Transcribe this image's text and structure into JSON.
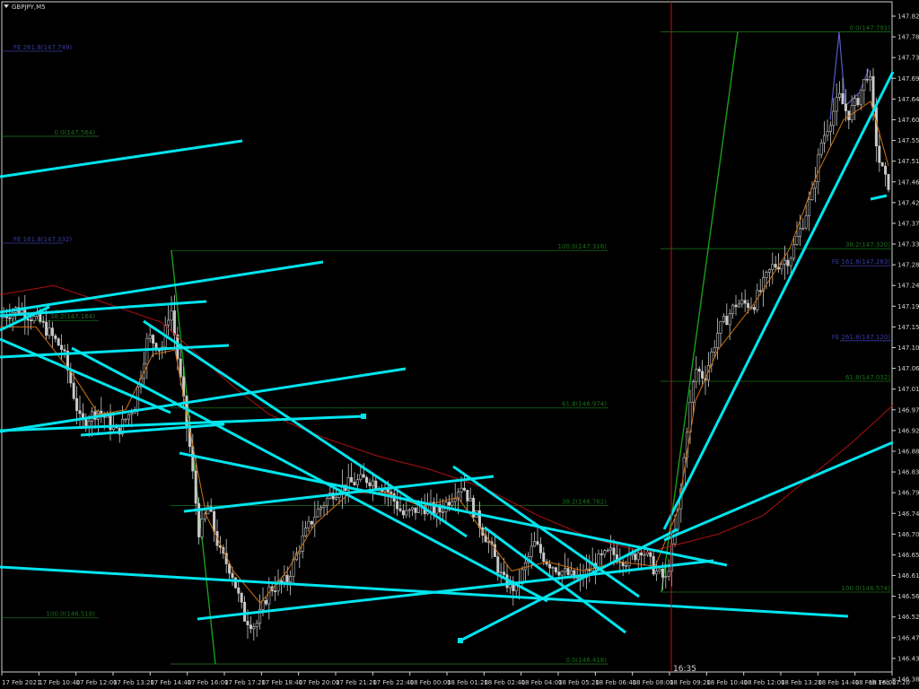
{
  "symbol_title": "GBPJPY,M5",
  "cursor_time": "16:35",
  "colors": {
    "background": "#000000",
    "grid_border": "#d0d0d0",
    "trendline": "#00e5ee",
    "fib_retracement": "#1a6e1a",
    "fib_expansion": "#3a3aa0",
    "ma_fast": "#d07010",
    "ma_slow": "#b01010",
    "candle": "#c8c8c8",
    "cursor_line": "#c01010"
  },
  "chart_data": {
    "type": "candlestick",
    "ylim": [
      146.385,
      147.82
    ],
    "y_ticks": [
      "147.825",
      "147.780",
      "147.735",
      "147.690",
      "147.645",
      "147.600",
      "147.555",
      "147.510",
      "147.465",
      "147.420",
      "147.375",
      "147.330",
      "147.285",
      "147.240",
      "147.195",
      "147.150",
      "147.105",
      "147.060",
      "147.015",
      "146.970",
      "146.925",
      "146.880",
      "146.835",
      "146.790",
      "146.745",
      "146.700",
      "146.655",
      "146.610",
      "146.565",
      "146.520",
      "146.475",
      "146.430",
      "146.385"
    ],
    "x_ticks": [
      "17 Feb 2021",
      "17 Feb 10:40",
      "17 Feb 12:00",
      "17 Feb 13:20",
      "17 Feb 14:40",
      "17 Feb 16:00",
      "17 Feb 17:20",
      "17 Feb 18:40",
      "17 Feb 20:00",
      "17 Feb 21:20",
      "17 Feb 22:40",
      "18 Feb 00:00",
      "18 Feb 01:20",
      "18 Feb 02:40",
      "18 Feb 04:00",
      "18 Feb 05:20",
      "18 Feb 06:40",
      "18 Feb 08:00",
      "18 Feb 09:20",
      "18 Feb 10:40",
      "18 Feb 12:00",
      "18 Feb 13:20",
      "18 Feb 14:40",
      "18 Feb 16:00",
      "18 Feb 17:20"
    ],
    "price_path": [
      [
        0,
        147.17
      ],
      [
        20,
        147.19
      ],
      [
        45,
        147.16
      ],
      [
        70,
        147.1
      ],
      [
        90,
        146.94
      ],
      [
        110,
        146.97
      ],
      [
        130,
        146.92
      ],
      [
        150,
        146.98
      ],
      [
        165,
        147.13
      ],
      [
        180,
        147.1
      ],
      [
        190,
        147.2
      ],
      [
        200,
        147.05
      ],
      [
        212,
        146.88
      ],
      [
        222,
        146.7
      ],
      [
        232,
        146.76
      ],
      [
        245,
        146.66
      ],
      [
        258,
        146.62
      ],
      [
        272,
        146.52
      ],
      [
        285,
        146.5
      ],
      [
        300,
        146.58
      ],
      [
        320,
        146.6
      ],
      [
        335,
        146.68
      ],
      [
        350,
        146.74
      ],
      [
        370,
        146.79
      ],
      [
        390,
        146.81
      ],
      [
        410,
        146.82
      ],
      [
        430,
        146.8
      ],
      [
        450,
        146.74
      ],
      [
        470,
        146.76
      ],
      [
        490,
        146.75
      ],
      [
        515,
        146.81
      ],
      [
        530,
        146.74
      ],
      [
        545,
        146.68
      ],
      [
        560,
        146.6
      ],
      [
        575,
        146.58
      ],
      [
        595,
        146.68
      ],
      [
        610,
        146.64
      ],
      [
        625,
        146.62
      ],
      [
        645,
        146.6
      ],
      [
        665,
        146.64
      ],
      [
        680,
        146.66
      ],
      [
        700,
        146.64
      ],
      [
        715,
        146.67
      ],
      [
        730,
        146.62
      ],
      [
        742,
        146.6
      ],
      [
        750,
        146.68
      ],
      [
        758,
        146.78
      ],
      [
        766,
        146.94
      ],
      [
        775,
        147.06
      ],
      [
        785,
        147.04
      ],
      [
        800,
        147.14
      ],
      [
        820,
        147.2
      ],
      [
        840,
        147.2
      ],
      [
        860,
        147.28
      ],
      [
        880,
        147.3
      ],
      [
        895,
        147.38
      ],
      [
        905,
        147.44
      ],
      [
        915,
        147.55
      ],
      [
        925,
        147.6
      ],
      [
        935,
        147.65
      ],
      [
        945,
        147.61
      ],
      [
        955,
        147.64
      ],
      [
        968,
        147.71
      ],
      [
        978,
        147.52
      ],
      [
        988,
        147.46
      ]
    ],
    "ma_fast_path": [
      [
        0,
        147.15
      ],
      [
        40,
        147.15
      ],
      [
        80,
        147.05
      ],
      [
        110,
        146.96
      ],
      [
        140,
        146.97
      ],
      [
        170,
        147.09
      ],
      [
        195,
        147.1
      ],
      [
        210,
        146.94
      ],
      [
        230,
        146.74
      ],
      [
        260,
        146.62
      ],
      [
        290,
        146.55
      ],
      [
        320,
        146.62
      ],
      [
        350,
        146.72
      ],
      [
        390,
        146.79
      ],
      [
        430,
        146.79
      ],
      [
        470,
        146.76
      ],
      [
        510,
        146.78
      ],
      [
        540,
        146.7
      ],
      [
        570,
        146.62
      ],
      [
        610,
        146.64
      ],
      [
        650,
        146.62
      ],
      [
        690,
        146.64
      ],
      [
        730,
        146.63
      ],
      [
        755,
        146.75
      ],
      [
        775,
        146.99
      ],
      [
        800,
        147.1
      ],
      [
        840,
        147.2
      ],
      [
        880,
        147.32
      ],
      [
        910,
        147.48
      ],
      [
        940,
        147.6
      ],
      [
        970,
        147.64
      ],
      [
        990,
        147.5
      ]
    ],
    "ma_slow_path": [
      [
        0,
        147.22
      ],
      [
        60,
        147.24
      ],
      [
        120,
        147.2
      ],
      [
        180,
        147.16
      ],
      [
        220,
        147.09
      ],
      [
        260,
        147.02
      ],
      [
        300,
        146.96
      ],
      [
        360,
        146.91
      ],
      [
        420,
        146.87
      ],
      [
        480,
        146.84
      ],
      [
        540,
        146.8
      ],
      [
        600,
        146.74
      ],
      [
        660,
        146.69
      ],
      [
        720,
        146.66
      ],
      [
        760,
        146.68
      ],
      [
        800,
        146.7
      ],
      [
        850,
        146.74
      ],
      [
        900,
        146.82
      ],
      [
        950,
        146.9
      ],
      [
        995,
        146.98
      ]
    ]
  },
  "fib_retracement_1": {
    "levels": [
      {
        "text": "100.0(147.316)",
        "price": 147.316
      },
      {
        "text": "61.8(146.974)",
        "price": 146.974
      },
      {
        "text": "38.2(146.762)",
        "price": 146.762
      },
      {
        "text": "0.0(146.418)",
        "price": 146.418
      }
    ]
  },
  "fib_retracement_2": {
    "levels": [
      {
        "text": "0.0(147.791)",
        "price": 147.791
      },
      {
        "text": "38.2(147.320)",
        "price": 147.32
      },
      {
        "text": "61.8(147.032)",
        "price": 147.032
      },
      {
        "text": "100.0(146.574)",
        "price": 146.574
      }
    ]
  },
  "fib_left_levels": [
    {
      "text": "0.0(147.564)",
      "price": 147.564
    },
    {
      "text": "38.2(147.164)",
      "price": 147.164
    },
    {
      "text": "100.0(146.518)",
      "price": 146.518
    }
  ],
  "fib_expansion_labels": [
    {
      "text": "FE 261.8(147.749)",
      "price": 147.749,
      "side": "left"
    },
    {
      "text": "FE 161.8(147.332)",
      "price": 147.332,
      "side": "left"
    },
    {
      "text": "FE 161.8(147.283)",
      "price": 147.283,
      "side": "right"
    },
    {
      "text": "FE 261.8(147.120)",
      "price": 147.12,
      "side": "right"
    }
  ],
  "trendlines": [
    [
      [
        0,
        197
      ],
      [
        270,
        157
      ]
    ],
    [
      [
        0,
        348
      ],
      [
        360,
        292
      ]
    ],
    [
      [
        0,
        352
      ],
      [
        230,
        336
      ]
    ],
    [
      [
        0,
        398
      ],
      [
        255,
        385
      ]
    ],
    [
      [
        0,
        368
      ],
      [
        55,
        342
      ]
    ],
    [
      [
        0,
        378
      ],
      [
        190,
        460
      ]
    ],
    [
      [
        80,
        388
      ],
      [
        610,
        670
      ]
    ],
    [
      [
        160,
        358
      ],
      [
        520,
        598
      ]
    ],
    [
      [
        200,
        505
      ],
      [
        810,
        630
      ]
    ],
    [
      [
        0,
        480
      ],
      [
        405,
        464
      ]
    ],
    [
      [
        0,
        481
      ],
      [
        452,
        411
      ]
    ],
    [
      [
        90,
        485
      ],
      [
        250,
        473
      ]
    ],
    [
      [
        205,
        570
      ],
      [
        550,
        531
      ]
    ],
    [
      [
        220,
        690
      ],
      [
        795,
        625
      ]
    ],
    [
      [
        0,
        632
      ],
      [
        945,
        687
      ]
    ],
    [
      [
        505,
        520
      ],
      [
        712,
        665
      ]
    ],
    [
      [
        540,
        588
      ],
      [
        697,
        705
      ]
    ],
    [
      [
        513,
        714
      ],
      [
        755,
        590
      ]
    ],
    [
      [
        740,
        590
      ],
      [
        995,
        80
      ]
    ],
    [
      [
        740,
        602
      ],
      [
        995,
        493
      ]
    ],
    [
      [
        970,
        222
      ],
      [
        988,
        218
      ]
    ],
    [
      [
        235,
        474
      ],
      [
        250,
        472
      ]
    ]
  ]
}
